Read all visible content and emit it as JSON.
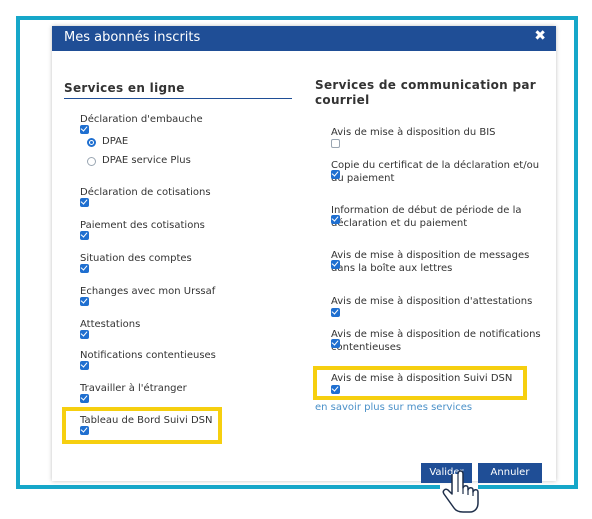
{
  "dialog": {
    "title": "Mes abonnés inscrits",
    "close_icon": "close-icon"
  },
  "left": {
    "heading": "Services en ligne",
    "items": [
      {
        "label": "Déclaration d'embauche",
        "checked": true
      },
      {
        "label": "Déclaration de cotisations",
        "checked": true
      },
      {
        "label": "Paiement des cotisations",
        "checked": true
      },
      {
        "label": "Situation des comptes",
        "checked": true
      },
      {
        "label": "Echanges avec mon Urssaf",
        "checked": true
      },
      {
        "label": "Attestations",
        "checked": true
      },
      {
        "label": "Notifications contentieuses",
        "checked": true
      },
      {
        "label": "Travailler à l'étranger",
        "checked": true
      },
      {
        "label": "Tableau de Bord Suivi DSN",
        "checked": true
      }
    ],
    "radios": [
      {
        "label": "DPAE",
        "selected": true
      },
      {
        "label": "DPAE service Plus",
        "selected": false
      }
    ]
  },
  "right": {
    "heading_line1": "Services de communication par",
    "heading_line2": "courriel",
    "items": [
      {
        "line1": "Avis de mise à disposition du BIS",
        "line2": "",
        "checked": false
      },
      {
        "line1": "Copie du certificat de la déclaration et/ou",
        "line2": "du paiement",
        "checked": true
      },
      {
        "line1": "Information de début de période de la",
        "line2": "déclaration et du paiement",
        "checked": true
      },
      {
        "line1": "Avis de mise à disposition de messages",
        "line2": "dans la boîte aux lettres",
        "checked": true
      },
      {
        "line1": "Avis de mise à disposition d'attestations",
        "line2": "",
        "checked": true
      },
      {
        "line1": "Avis de mise à disposition de notifications",
        "line2": "contentieuses",
        "checked": true
      },
      {
        "line1": "Avis de mise à disposition Suivi DSN",
        "line2": "",
        "checked": true
      }
    ],
    "link": "en savoir plus sur mes services"
  },
  "buttons": {
    "validate": "Valider",
    "cancel": "Annuler"
  },
  "colors": {
    "accent": "#1f4e96",
    "frame": "#16a7c9",
    "highlight": "#f6cf0f",
    "check": "#1f6fd0",
    "link": "#4a90c8"
  }
}
